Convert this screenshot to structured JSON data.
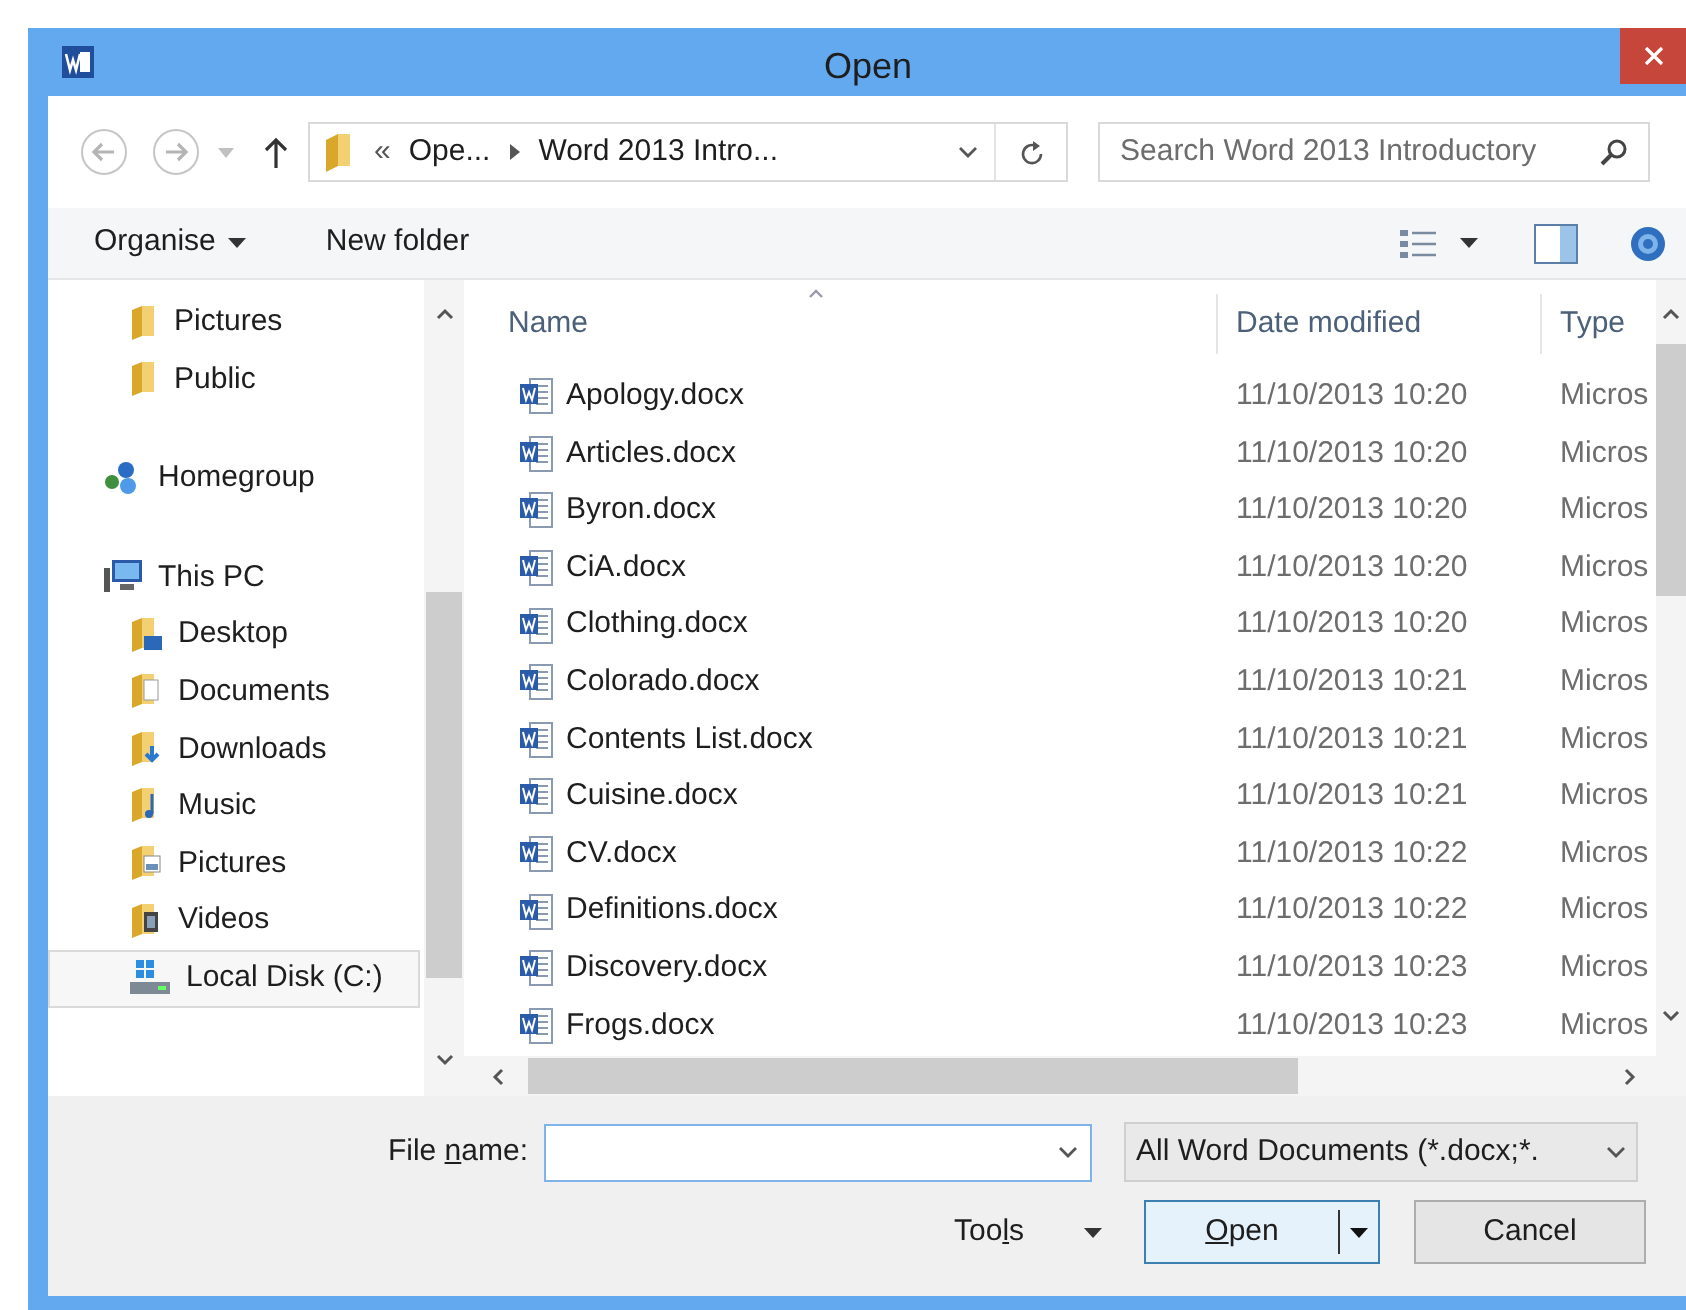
{
  "window": {
    "title": "Open"
  },
  "navigation": {
    "breadcrumb": [
      "«",
      "Ope...",
      "Word 2013 Intro..."
    ],
    "search": {
      "placeholder": "Search Word 2013 Introductory"
    }
  },
  "toolbar": {
    "buttons": [
      {
        "label": "Organise",
        "dropdown": true
      },
      {
        "label": "New folder",
        "dropdown": false
      }
    ]
  },
  "sidebar": {
    "sections": [
      {
        "children": [
          {
            "label": "Pictures",
            "kind": "folder",
            "selected": false
          },
          {
            "label": "Public",
            "kind": "folder",
            "selected": false
          }
        ]
      },
      {
        "label": "Homegroup",
        "kind": "homegroup",
        "selected": false
      },
      {
        "label": "This PC",
        "kind": "computer",
        "selected": false,
        "children": [
          {
            "label": "Desktop",
            "kind": "desktop",
            "selected": false
          },
          {
            "label": "Documents",
            "kind": "documents",
            "selected": false
          },
          {
            "label": "Downloads",
            "kind": "downloads",
            "selected": false
          },
          {
            "label": "Music",
            "kind": "music",
            "selected": false
          },
          {
            "label": "Pictures",
            "kind": "pictures",
            "selected": false
          },
          {
            "label": "Videos",
            "kind": "videos",
            "selected": false
          },
          {
            "label": "Local Disk (C:)",
            "kind": "disk",
            "selected": true
          }
        ]
      }
    ]
  },
  "file_list": {
    "columns": [
      "Name",
      "Date modified",
      "Type"
    ],
    "rows": [
      {
        "name": "Apology.docx",
        "date": "11/10/2013 10:20",
        "type": "Micros"
      },
      {
        "name": "Articles.docx",
        "date": "11/10/2013 10:20",
        "type": "Micros"
      },
      {
        "name": "Byron.docx",
        "date": "11/10/2013 10:20",
        "type": "Micros"
      },
      {
        "name": "CiA.docx",
        "date": "11/10/2013 10:20",
        "type": "Micros"
      },
      {
        "name": "Clothing.docx",
        "date": "11/10/2013 10:20",
        "type": "Micros"
      },
      {
        "name": "Colorado.docx",
        "date": "11/10/2013 10:21",
        "type": "Micros"
      },
      {
        "name": "Contents List.docx",
        "date": "11/10/2013 10:21",
        "type": "Micros"
      },
      {
        "name": "Cuisine.docx",
        "date": "11/10/2013 10:21",
        "type": "Micros"
      },
      {
        "name": "CV.docx",
        "date": "11/10/2013 10:22",
        "type": "Micros"
      },
      {
        "name": "Definitions.docx",
        "date": "11/10/2013 10:22",
        "type": "Micros"
      },
      {
        "name": "Discovery.docx",
        "date": "11/10/2013 10:23",
        "type": "Micros"
      },
      {
        "name": "Frogs.docx",
        "date": "11/10/2013 10:23",
        "type": "Micros"
      }
    ]
  },
  "bottom": {
    "file_name": {
      "label": {
        "before": "File ",
        "key": "n",
        "after": "ame:"
      }
    },
    "file_type": "All Word Documents (*.docx;*.",
    "tools": {
      "before": "Too",
      "key": "l",
      "after": "s"
    },
    "open": {
      "key": "O",
      "after": "pen"
    },
    "cancel": "Cancel"
  }
}
